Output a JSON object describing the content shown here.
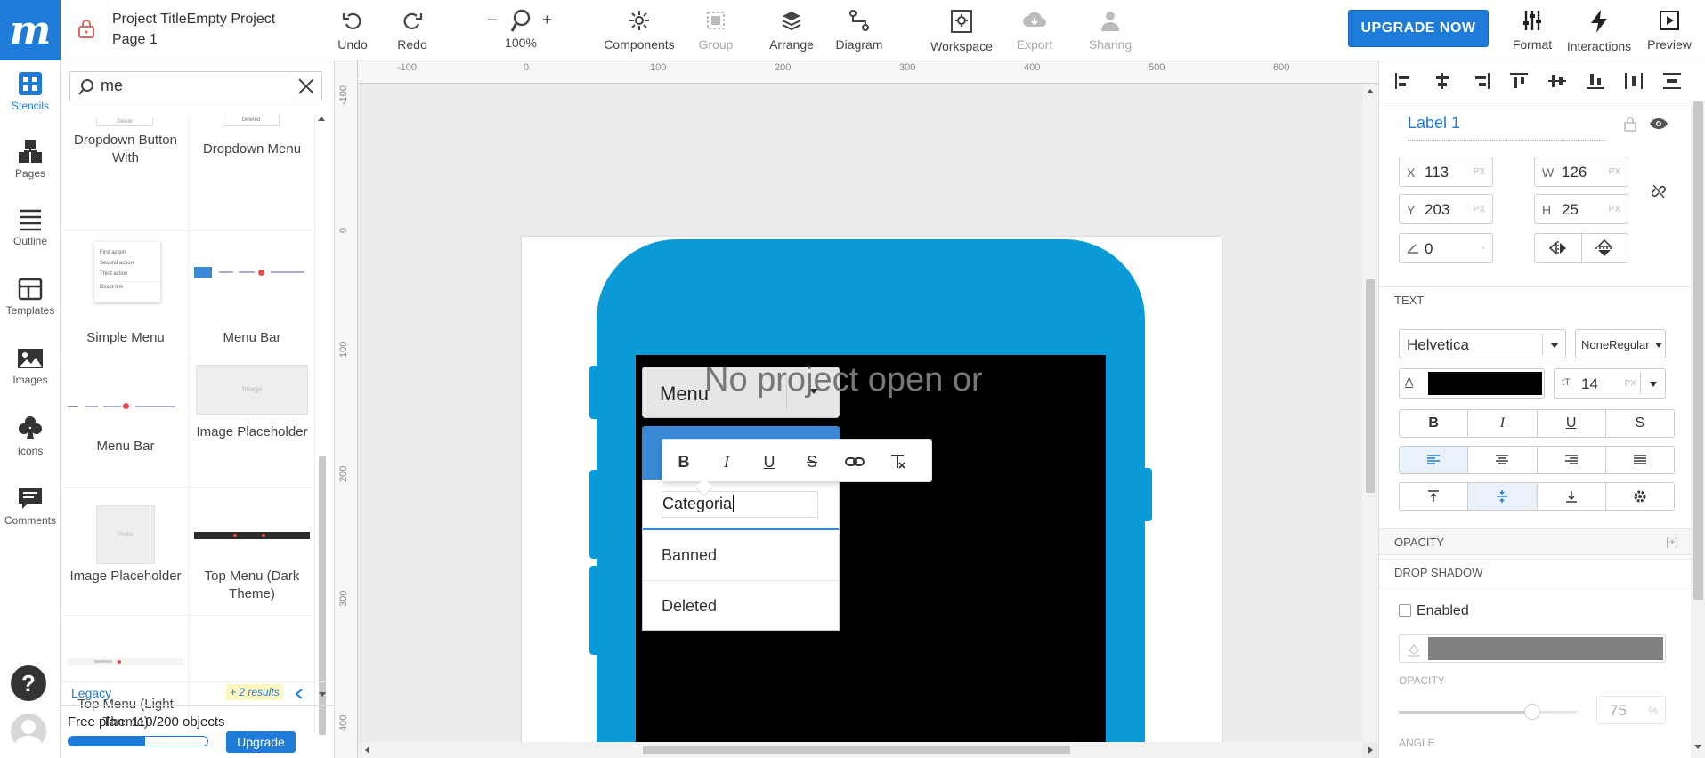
{
  "header": {
    "logo": "m",
    "project_title": "Project TitleEmpty Project",
    "page_name": "Page 1",
    "undo": "Undo",
    "redo": "Redo",
    "zoom_minus": "−",
    "zoom_plus": "+",
    "zoom_level": "100%",
    "components": "Components",
    "group": "Group",
    "arrange": "Arrange",
    "diagram": "Diagram",
    "workspace": "Workspace",
    "export": "Export",
    "sharing": "Sharing",
    "upgrade_now": "UPGRADE NOW",
    "format": "Format",
    "interactions": "Interactions",
    "preview": "Preview"
  },
  "leftnav": {
    "items": [
      {
        "label": "Stencils",
        "icon": "stencils-icon"
      },
      {
        "label": "Pages",
        "icon": "pages-icon"
      },
      {
        "label": "Outline",
        "icon": "outline-icon"
      },
      {
        "label": "Templates",
        "icon": "templates-icon"
      },
      {
        "label": "Images",
        "icon": "images-icon"
      },
      {
        "label": "Icons",
        "icon": "club-icon"
      },
      {
        "label": "Comments",
        "icon": "comments-icon"
      }
    ],
    "help": "?"
  },
  "stencils": {
    "search_value": "me",
    "cells": [
      {
        "label": "Dropdown Button With"
      },
      {
        "label": "Dropdown Menu"
      },
      {
        "label": "Simple Menu"
      },
      {
        "label": "Menu Bar"
      },
      {
        "label": "Menu Bar"
      },
      {
        "label": "Image Placeholder"
      },
      {
        "label": "Image Placeholder"
      },
      {
        "label": "Top Menu (Dark Theme)"
      },
      {
        "label": "Top Menu (Light Theme)"
      }
    ],
    "thumb_text": {
      "dropdown_button": "Delete",
      "dropdown_menu": "Deleted",
      "simple_menu": [
        "First action",
        "Second action",
        "Third action",
        "Direct link"
      ],
      "image": "Image"
    },
    "legacy": "Legacy",
    "more_results": "+ 2 results",
    "free_plan": "Free plan: 110/200 objects",
    "plan_used_fraction": 0.55,
    "upgrade": "Upgrade"
  },
  "canvas": {
    "ruler_top": [
      "-100",
      "0",
      "100",
      "200",
      "300",
      "400",
      "500",
      "600"
    ],
    "ruler_left": [
      "-100",
      "0",
      "100",
      "200",
      "300",
      "400"
    ],
    "no_project_text": "No project open or",
    "menu_label": "Menu",
    "dropdown_items": [
      "Categoria",
      "Banned",
      "Deleted"
    ],
    "format_toolbar": [
      "B",
      "I",
      "U",
      "S"
    ]
  },
  "props": {
    "element_name": "Label 1",
    "x": "113",
    "y": "203",
    "w": "126",
    "h": "25",
    "angle": "0",
    "x_label": "X",
    "y_label": "Y",
    "w_label": "W",
    "h_label": "H",
    "unit": "PX",
    "deg": "°",
    "text_section": "TEXT",
    "font": "Helvetica",
    "font_style": "NoneRegular",
    "font_size": "14",
    "opacity_section": "OPACITY",
    "opacity_plus": "[+]",
    "drop_shadow_section": "DROP SHADOW",
    "enabled_label": "Enabled",
    "opacity_label": "OPACITY",
    "opacity_value": "75",
    "percent": "%",
    "angle_label": "ANGLE"
  },
  "colors": {
    "accent": "#1e7bd8",
    "phone": "#0a9ad8",
    "text_color_swatch": "#000000",
    "shadow_swatch": "#808080"
  }
}
